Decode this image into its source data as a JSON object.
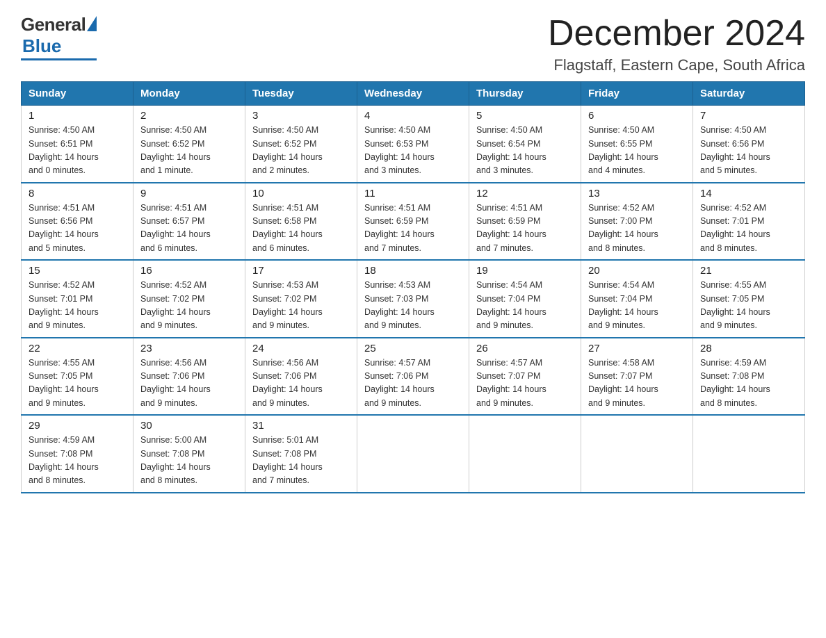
{
  "logo": {
    "general": "General",
    "blue": "Blue"
  },
  "header": {
    "month": "December 2024",
    "location": "Flagstaff, Eastern Cape, South Africa"
  },
  "weekdays": [
    "Sunday",
    "Monday",
    "Tuesday",
    "Wednesday",
    "Thursday",
    "Friday",
    "Saturday"
  ],
  "weeks": [
    [
      {
        "day": "1",
        "sunrise": "4:50 AM",
        "sunset": "6:51 PM",
        "daylight": "14 hours and 0 minutes."
      },
      {
        "day": "2",
        "sunrise": "4:50 AM",
        "sunset": "6:52 PM",
        "daylight": "14 hours and 1 minute."
      },
      {
        "day": "3",
        "sunrise": "4:50 AM",
        "sunset": "6:52 PM",
        "daylight": "14 hours and 2 minutes."
      },
      {
        "day": "4",
        "sunrise": "4:50 AM",
        "sunset": "6:53 PM",
        "daylight": "14 hours and 3 minutes."
      },
      {
        "day": "5",
        "sunrise": "4:50 AM",
        "sunset": "6:54 PM",
        "daylight": "14 hours and 3 minutes."
      },
      {
        "day": "6",
        "sunrise": "4:50 AM",
        "sunset": "6:55 PM",
        "daylight": "14 hours and 4 minutes."
      },
      {
        "day": "7",
        "sunrise": "4:50 AM",
        "sunset": "6:56 PM",
        "daylight": "14 hours and 5 minutes."
      }
    ],
    [
      {
        "day": "8",
        "sunrise": "4:51 AM",
        "sunset": "6:56 PM",
        "daylight": "14 hours and 5 minutes."
      },
      {
        "day": "9",
        "sunrise": "4:51 AM",
        "sunset": "6:57 PM",
        "daylight": "14 hours and 6 minutes."
      },
      {
        "day": "10",
        "sunrise": "4:51 AM",
        "sunset": "6:58 PM",
        "daylight": "14 hours and 6 minutes."
      },
      {
        "day": "11",
        "sunrise": "4:51 AM",
        "sunset": "6:59 PM",
        "daylight": "14 hours and 7 minutes."
      },
      {
        "day": "12",
        "sunrise": "4:51 AM",
        "sunset": "6:59 PM",
        "daylight": "14 hours and 7 minutes."
      },
      {
        "day": "13",
        "sunrise": "4:52 AM",
        "sunset": "7:00 PM",
        "daylight": "14 hours and 8 minutes."
      },
      {
        "day": "14",
        "sunrise": "4:52 AM",
        "sunset": "7:01 PM",
        "daylight": "14 hours and 8 minutes."
      }
    ],
    [
      {
        "day": "15",
        "sunrise": "4:52 AM",
        "sunset": "7:01 PM",
        "daylight": "14 hours and 9 minutes."
      },
      {
        "day": "16",
        "sunrise": "4:52 AM",
        "sunset": "7:02 PM",
        "daylight": "14 hours and 9 minutes."
      },
      {
        "day": "17",
        "sunrise": "4:53 AM",
        "sunset": "7:02 PM",
        "daylight": "14 hours and 9 minutes."
      },
      {
        "day": "18",
        "sunrise": "4:53 AM",
        "sunset": "7:03 PM",
        "daylight": "14 hours and 9 minutes."
      },
      {
        "day": "19",
        "sunrise": "4:54 AM",
        "sunset": "7:04 PM",
        "daylight": "14 hours and 9 minutes."
      },
      {
        "day": "20",
        "sunrise": "4:54 AM",
        "sunset": "7:04 PM",
        "daylight": "14 hours and 9 minutes."
      },
      {
        "day": "21",
        "sunrise": "4:55 AM",
        "sunset": "7:05 PM",
        "daylight": "14 hours and 9 minutes."
      }
    ],
    [
      {
        "day": "22",
        "sunrise": "4:55 AM",
        "sunset": "7:05 PM",
        "daylight": "14 hours and 9 minutes."
      },
      {
        "day": "23",
        "sunrise": "4:56 AM",
        "sunset": "7:06 PM",
        "daylight": "14 hours and 9 minutes."
      },
      {
        "day": "24",
        "sunrise": "4:56 AM",
        "sunset": "7:06 PM",
        "daylight": "14 hours and 9 minutes."
      },
      {
        "day": "25",
        "sunrise": "4:57 AM",
        "sunset": "7:06 PM",
        "daylight": "14 hours and 9 minutes."
      },
      {
        "day": "26",
        "sunrise": "4:57 AM",
        "sunset": "7:07 PM",
        "daylight": "14 hours and 9 minutes."
      },
      {
        "day": "27",
        "sunrise": "4:58 AM",
        "sunset": "7:07 PM",
        "daylight": "14 hours and 9 minutes."
      },
      {
        "day": "28",
        "sunrise": "4:59 AM",
        "sunset": "7:08 PM",
        "daylight": "14 hours and 8 minutes."
      }
    ],
    [
      {
        "day": "29",
        "sunrise": "4:59 AM",
        "sunset": "7:08 PM",
        "daylight": "14 hours and 8 minutes."
      },
      {
        "day": "30",
        "sunrise": "5:00 AM",
        "sunset": "7:08 PM",
        "daylight": "14 hours and 8 minutes."
      },
      {
        "day": "31",
        "sunrise": "5:01 AM",
        "sunset": "7:08 PM",
        "daylight": "14 hours and 7 minutes."
      },
      null,
      null,
      null,
      null
    ]
  ],
  "labels": {
    "sunrise": "Sunrise:",
    "sunset": "Sunset:",
    "daylight": "Daylight:"
  }
}
